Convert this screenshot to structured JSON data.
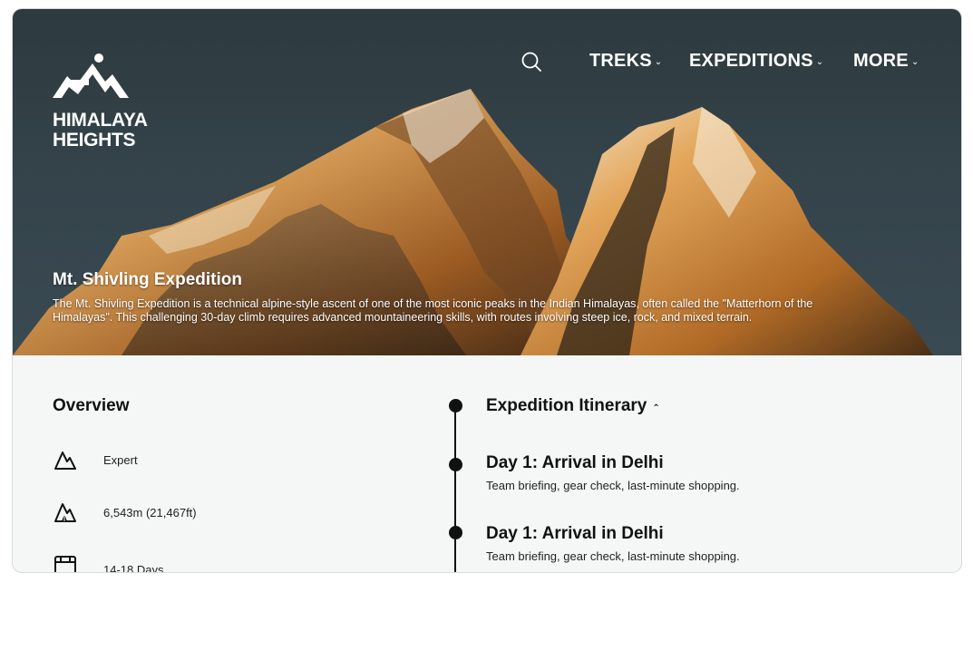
{
  "brand": {
    "name_line1": "HIMALAYA",
    "name_line2": "HEIGHTS"
  },
  "nav": {
    "items": [
      {
        "label": "TREKS"
      },
      {
        "label": "EXPEDITIONS"
      },
      {
        "label": "MORE"
      }
    ]
  },
  "hero": {
    "title": "Mt. Shivling Expedition",
    "description": "The Mt. Shivling Expedition is a technical alpine-style ascent of one of the most iconic peaks in the Indian Himalayas, often called the \"Matterhorn of the Himalayas\". This challenging 30-day climb requires advanced mountaineering skills, with routes involving steep ice, rock, and mixed terrain."
  },
  "overview": {
    "title": "Overview",
    "items": [
      {
        "icon": "mountain-icon",
        "label": "Expert"
      },
      {
        "icon": "altitude-icon",
        "label": "6,543m (21,467ft)"
      },
      {
        "icon": "calendar-icon",
        "label": "14-18 Days"
      }
    ]
  },
  "itinerary": {
    "title": "Expedition Itinerary",
    "days": [
      {
        "title": "Day 1: Arrival in Delhi",
        "text": "Team briefing, gear check, last-minute shopping."
      },
      {
        "title": "Day 1: Arrival in Delhi",
        "text": "Team briefing, gear check, last-minute shopping."
      }
    ]
  },
  "colors": {
    "text": "#111111",
    "panel": "#f5f7f6",
    "sky": "#34434a",
    "rock_light": "#d89a4a"
  }
}
